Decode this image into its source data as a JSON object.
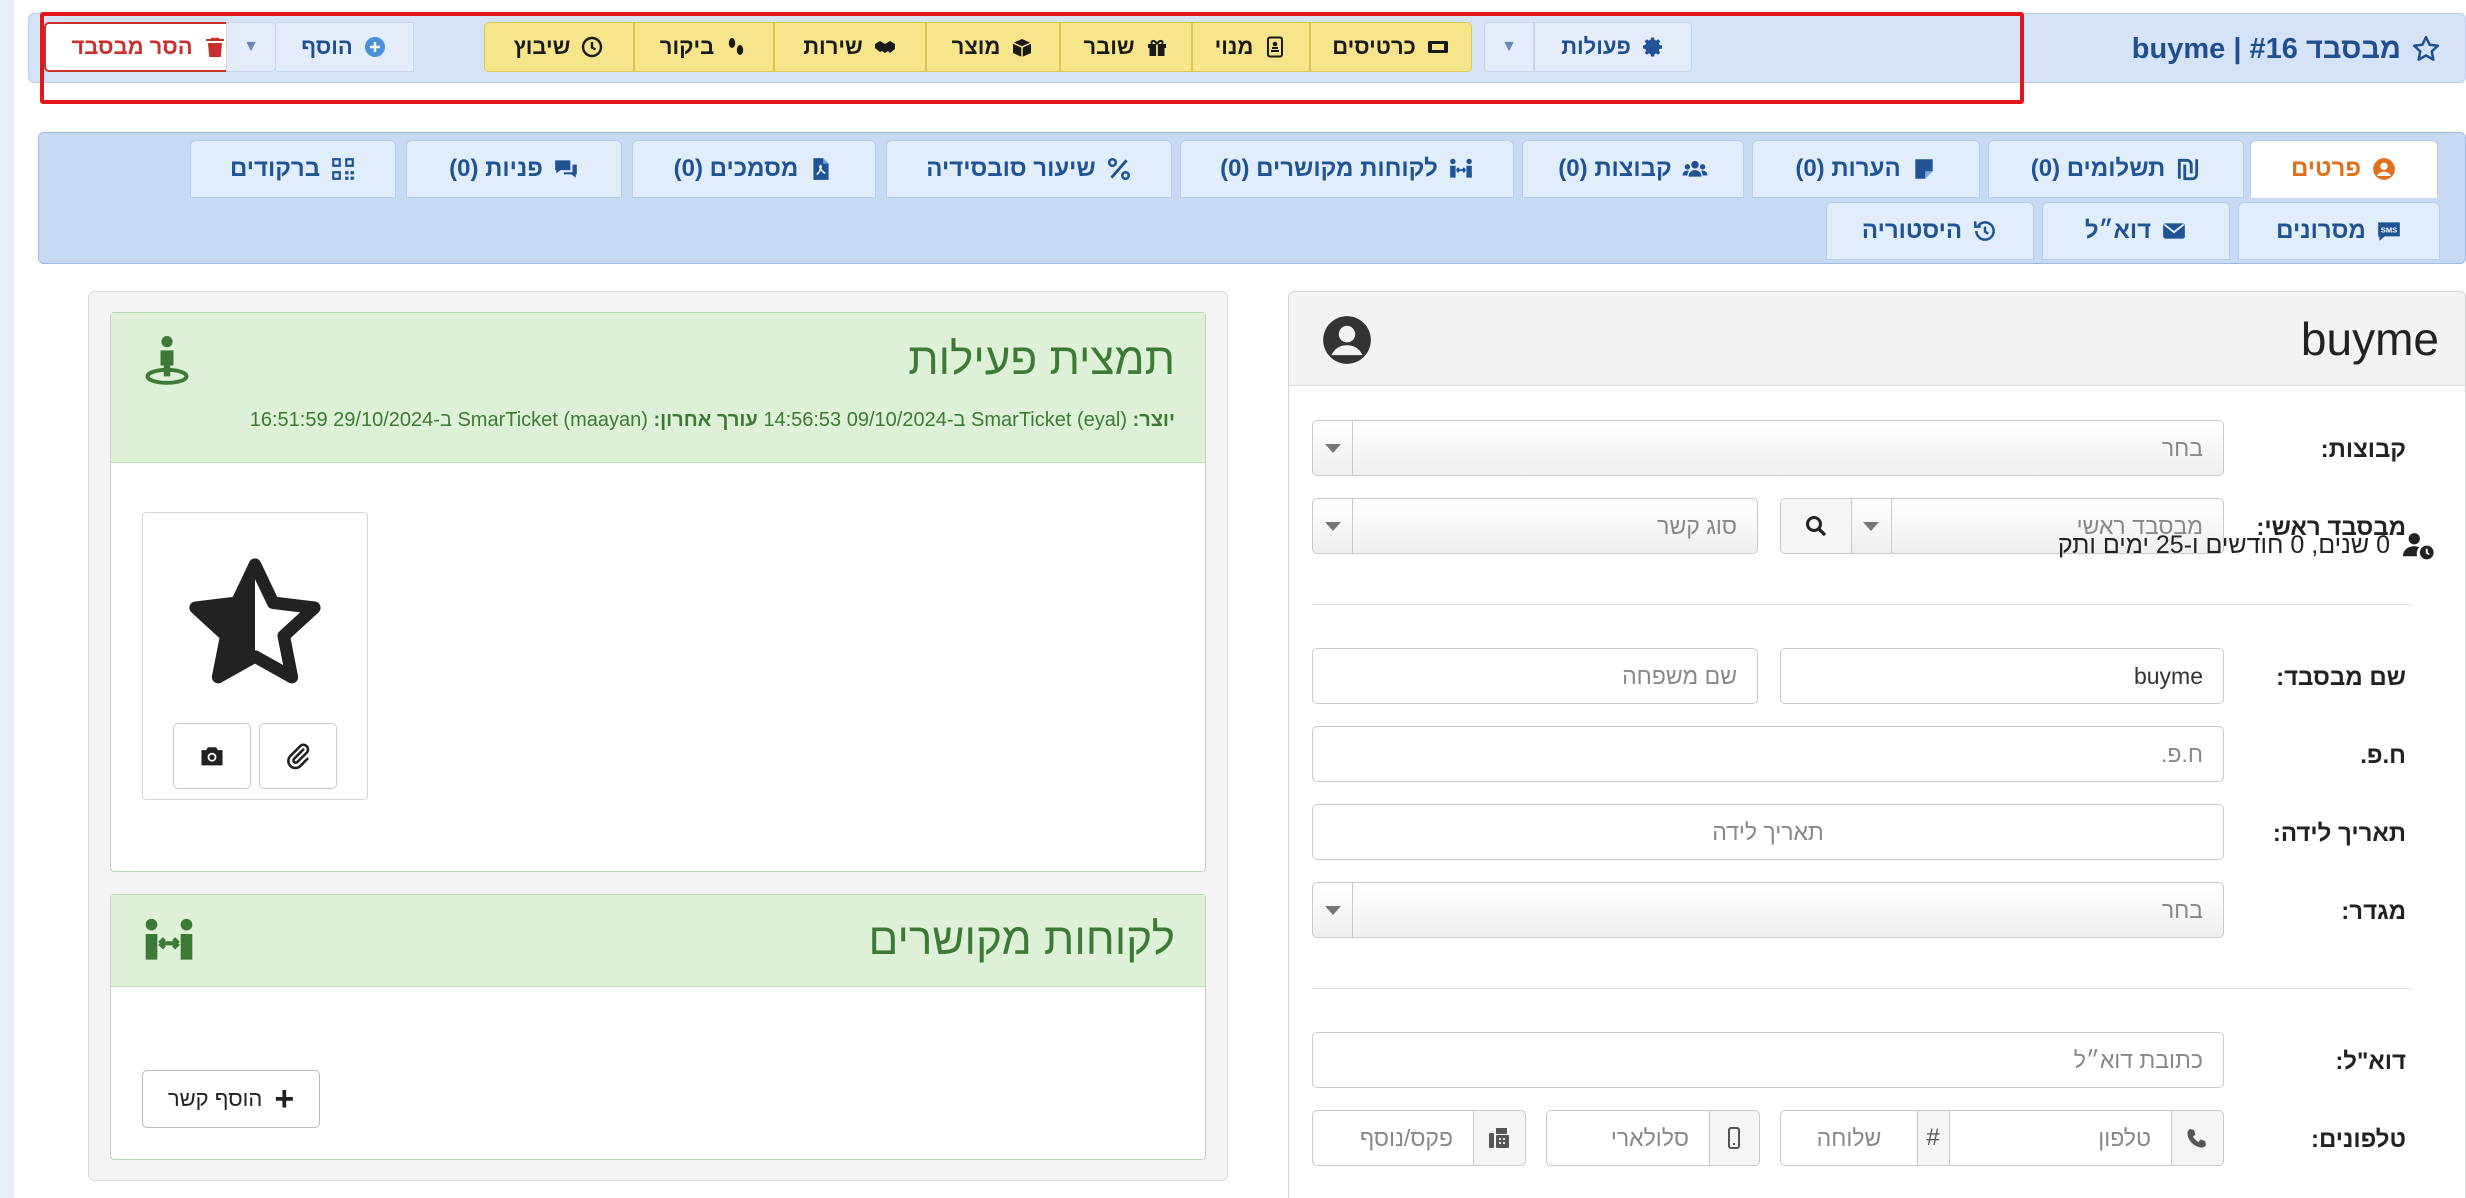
{
  "header": {
    "title": "מבסבד #16 | buyme",
    "remove_label": "הסר מבסבד",
    "add_label": "הוסף",
    "actions_label": "פעולות"
  },
  "toolbar_yellow": [
    {
      "label": "שיבוץ",
      "icon": "clock-icon"
    },
    {
      "label": "ביקור",
      "icon": "footprints-icon"
    },
    {
      "label": "שירות",
      "icon": "handshake-icon"
    },
    {
      "label": "מוצר",
      "icon": "box-icon"
    },
    {
      "label": "שובר",
      "icon": "gift-icon"
    },
    {
      "label": "מנוי",
      "icon": "id-card-icon"
    },
    {
      "label": "כרטיסים",
      "icon": "ticket-icon"
    }
  ],
  "tabs_row1": [
    {
      "label": "פרטים",
      "icon": "user-circle-icon",
      "active": true
    },
    {
      "label": "תשלומים (0)",
      "icon": "shekel-icon"
    },
    {
      "label": "הערות (0)",
      "icon": "note-icon"
    },
    {
      "label": "קבוצות (0)",
      "icon": "users-icon"
    },
    {
      "label": "לקוחות מקושרים (0)",
      "icon": "linked-people-icon"
    },
    {
      "label": "שיעור סובסידיה",
      "icon": "percent-icon"
    },
    {
      "label": "מסמכים (0)",
      "icon": "file-pdf-icon"
    },
    {
      "label": "פניות (0)",
      "icon": "comments-icon"
    },
    {
      "label": "ברקודים",
      "icon": "qrcode-icon"
    }
  ],
  "tabs_row2": [
    {
      "label": "מסרונים",
      "icon": "sms-icon"
    },
    {
      "label": "דוא״ל",
      "icon": "envelope-icon"
    },
    {
      "label": "היסטוריה",
      "icon": "history-icon"
    }
  ],
  "details": {
    "name": "buyme",
    "groups_label": "קבוצות:",
    "groups_placeholder": "בחר",
    "main_label": "מבסבד ראשי:",
    "main_placeholder": "מבסבד ראשי",
    "relation_placeholder": "סוג קשר",
    "fullname_label": "שם מבסבד:",
    "firstname_value": "buyme",
    "lastname_placeholder": "שם משפחה",
    "company_label": "ח.פ.",
    "company_placeholder": "ח.פ.",
    "birth_label": "תאריך לידה:",
    "birth_placeholder": "תאריך לידה",
    "gender_label": "מגדר:",
    "gender_placeholder": "בחר",
    "email_label": "דוא\"ל:",
    "email_placeholder": "כתובת דוא״ל",
    "phones_label": "טלפונים:",
    "phone_placeholder": "טלפון",
    "ext_placeholder": "שלוחה",
    "ext_symbol": "#",
    "mobile_placeholder": "סלולארי",
    "fax_placeholder": "פקס/נוסף"
  },
  "activity": {
    "title": "תמצית פעילות",
    "creator_label": "יוצר:",
    "creator_value": "SmarTicket (eyal) ב-09/10/2024 14:56:53",
    "editor_label": "עורך אחרון:",
    "editor_value": "SmarTicket (maayan) ב-29/10/2024 16:51:59",
    "duration": "0 שנים, 0 חודשים ו-25 ימים ותק"
  },
  "linked": {
    "title": "לקוחות מקושרים",
    "add_label": "הוסף קשר"
  },
  "colors": {
    "accent": "#1f4f8f",
    "active_tab": "#e0701c",
    "green_title": "#3c7a35",
    "remove_red": "#c9302c",
    "toolbar_yellow": "#f6e58a",
    "frame_red": "#e4161b"
  }
}
